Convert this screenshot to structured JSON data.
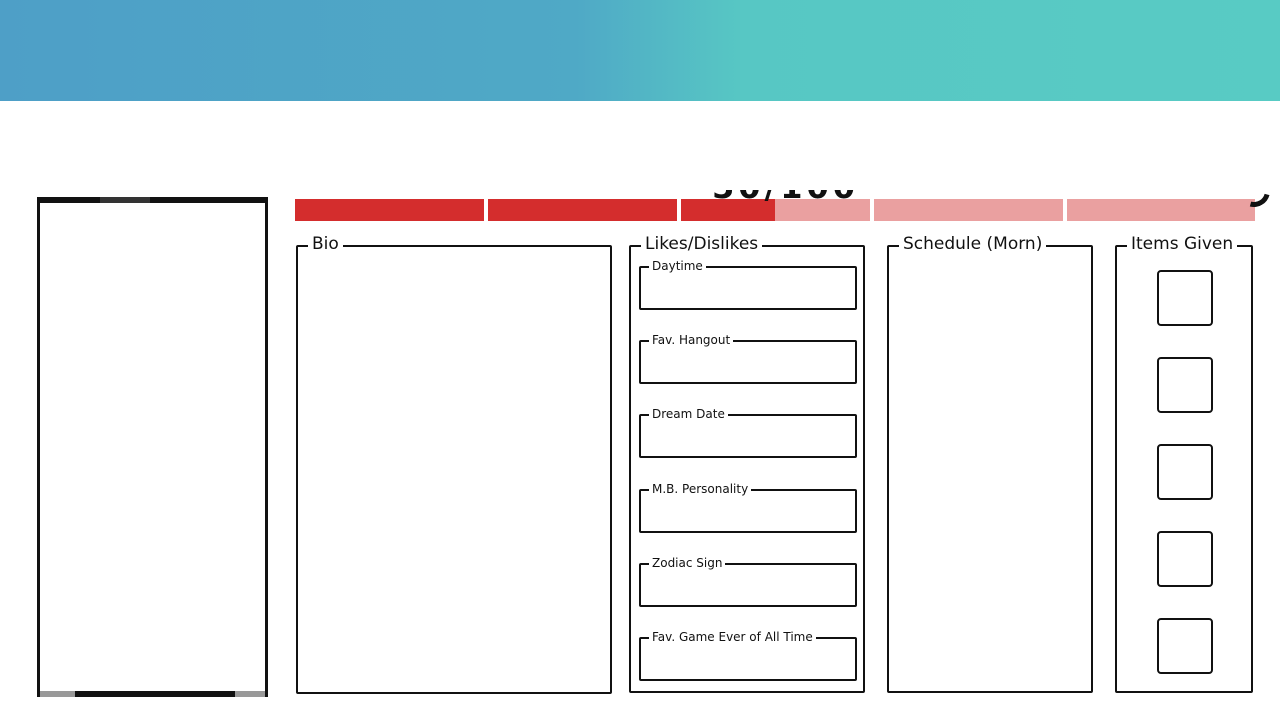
{
  "meter": {
    "readout": "50/100",
    "fill_percent": 50,
    "segments": 5,
    "colors": {
      "filled": "#d42d2d",
      "empty": "#eaa0a0"
    }
  },
  "banner": {
    "colors": [
      "#4e9fc7",
      "#58cbc4"
    ]
  },
  "panels": {
    "bio": {
      "title": "Bio"
    },
    "likes": {
      "title": "Likes/Dislikes",
      "fields": [
        {
          "label": "Daytime"
        },
        {
          "label": "Fav. Hangout"
        },
        {
          "label": "Dream Date"
        },
        {
          "label": "M.B. Personality"
        },
        {
          "label": "Zodiac Sign"
        },
        {
          "label": "Fav. Game Ever of All Time"
        }
      ]
    },
    "schedule": {
      "title": "Schedule (Morn)"
    },
    "items": {
      "title": "Items Given",
      "slot_count": 5
    }
  }
}
